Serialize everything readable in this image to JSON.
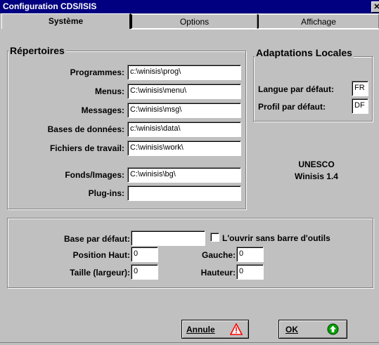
{
  "window": {
    "title": "Configuration CDS/ISIS",
    "close_label": "✕"
  },
  "tabs": [
    {
      "label": "Système",
      "active": true
    },
    {
      "label": "Options",
      "active": false
    },
    {
      "label": "Affichage",
      "active": false
    }
  ],
  "repertoires": {
    "legend": "Répertoires",
    "programmes": {
      "label": "Programmes:",
      "value": "c:\\winisis\\prog\\"
    },
    "menus": {
      "label": "Menus:",
      "value": "C:\\winisis\\menu\\"
    },
    "messages": {
      "label": "Messages:",
      "value": "C:\\winisis\\msg\\"
    },
    "bases": {
      "label": "Bases de données:",
      "value": "c:\\winisis\\data\\"
    },
    "fichiers": {
      "label": "Fichiers de travail:",
      "value": "C:\\winisis\\work\\"
    },
    "fonds": {
      "label": "Fonds/Images:",
      "value": "C:\\winisis\\bg\\"
    },
    "plugins": {
      "label": "Plug-ins:",
      "value": ""
    }
  },
  "adaptations": {
    "legend": "Adaptations Locales",
    "langue": {
      "label": "Langue par défaut:",
      "value": "FR"
    },
    "profil": {
      "label": "Profil par défaut:",
      "value": "DF"
    }
  },
  "about": {
    "org": "UNESCO",
    "version": "Winisis 1.4"
  },
  "defaults": {
    "base": {
      "label": "Base par défaut:",
      "value": ""
    },
    "ouvrir": {
      "label": "L'ouvrir sans barre d'outils",
      "checked": false
    },
    "position_haut": {
      "label": "Position Haut:",
      "value": "0"
    },
    "gauche": {
      "label": "Gauche:",
      "value": "0"
    },
    "taille": {
      "label": "Taille (largeur):",
      "value": "0"
    },
    "hauteur": {
      "label": "Hauteur:",
      "value": "0"
    }
  },
  "buttons": {
    "annule": {
      "label": "Annule",
      "icon": "warning-icon"
    },
    "ok": {
      "label": "OK",
      "icon": "green-up-arrow-icon"
    }
  },
  "colors": {
    "titlebar": "#000080",
    "face": "#c0c0c0",
    "ok_icon": "#00a000",
    "warn_icon": "#ff0000"
  }
}
